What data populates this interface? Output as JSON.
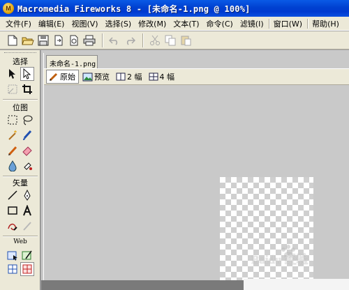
{
  "window": {
    "logo_text": "M",
    "title": "Macromedia Fireworks 8 - [未命名-1.png @ 100%]"
  },
  "menu": [
    {
      "label": "文件(F)"
    },
    {
      "label": "编辑(E)"
    },
    {
      "label": "视图(V)"
    },
    {
      "label": "选择(S)"
    },
    {
      "label": "修改(M)"
    },
    {
      "label": "文本(T)"
    },
    {
      "label": "命令(C)"
    },
    {
      "label": "滤镜(I)"
    },
    {
      "label": "窗口(W)"
    },
    {
      "label": "帮助(H)"
    }
  ],
  "toolbar": {
    "icons": [
      "new-file-icon",
      "open-file-icon",
      "save-icon",
      "import-icon",
      "export-icon",
      "print-icon",
      "undo-icon",
      "redo-icon",
      "cut-icon",
      "copy-icon",
      "paste-icon"
    ]
  },
  "tools": {
    "select_title": "选择",
    "bitmap_title": "位图",
    "vector_title": "矢量",
    "web_title": "Web"
  },
  "document": {
    "tab_label": "未命名-1.png",
    "views": [
      {
        "label": "原始",
        "active": true
      },
      {
        "label": "预览",
        "active": false
      },
      {
        "label": "2 幅",
        "active": false
      },
      {
        "label": "4 幅",
        "active": false
      }
    ]
  },
  "watermark": {
    "text": "Baidu 经验"
  },
  "colors": {
    "title_bar": "#0047d6",
    "chrome": "#ece9d8",
    "workspace": "#c9c9c9",
    "canvas_checker": "#cfcfcf"
  }
}
